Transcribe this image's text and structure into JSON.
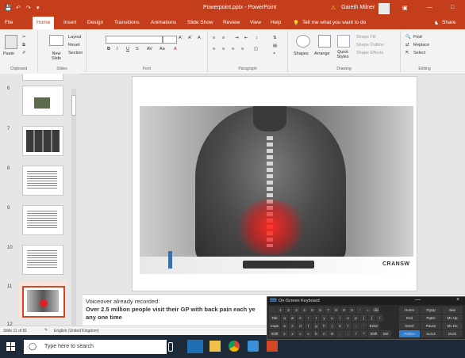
{
  "titlebar": {
    "quick_access": [
      "save-icon",
      "undo-icon",
      "redo-icon",
      "customize-icon"
    ],
    "doc_title": "Powerpoint.pptx - PowerPoint",
    "warning_icon": "warning-icon",
    "user_name": "Gareth Milner",
    "window_buttons": [
      "ribbon-display-icon",
      "minimize-icon",
      "maximize-icon"
    ]
  },
  "tabs": {
    "items": [
      "File",
      "Home",
      "Insert",
      "Design",
      "Transitions",
      "Animations",
      "Slide Show",
      "Review",
      "View",
      "Help"
    ],
    "active": "Home",
    "tell_me": "Tell me what you want to do",
    "share": "Share"
  },
  "ribbon": {
    "clipboard": {
      "paste": "Paste",
      "label": "Clipboard"
    },
    "slides": {
      "new_slide": "New Slide",
      "layout": "Layout",
      "reset": "Reset",
      "section": "Section",
      "label": "Slides"
    },
    "font": {
      "bold": "B",
      "italic": "I",
      "underline": "U",
      "strike": "S",
      "spacing": "AV",
      "label": "Font",
      "clear": "A"
    },
    "paragraph": {
      "label": "Paragraph"
    },
    "drawing": {
      "shapes": "Shapes",
      "arrange": "Arrange",
      "quick_styles": "Quick Styles",
      "shape_fill": "Shape Fill",
      "shape_outline": "Shape Outline",
      "shape_effects": "Shape Effects",
      "label": "Drawing"
    },
    "editing": {
      "find": "Find",
      "replace": "Replace",
      "select": "Select",
      "label": "Editing"
    }
  },
  "thumbs": {
    "items": [
      {
        "num": "6"
      },
      {
        "num": "7"
      },
      {
        "num": "8"
      },
      {
        "num": "9"
      },
      {
        "num": "10"
      },
      {
        "num": "11"
      },
      {
        "num": "12"
      }
    ],
    "selected": "11"
  },
  "slide": {
    "brand": "CRANSW",
    "notes_line1": "Voiceover already recorded:",
    "notes_line2": "Over 2.5 million people visit their GP with back pain each ye",
    "notes_line3": "any one time"
  },
  "status": {
    "slide_info": "Slide 11 of 81",
    "language": "English (United Kingdom)"
  },
  "taskbar": {
    "search_placeholder": "Type here to search",
    "apps": [
      "windows-icon",
      "file-explorer-icon",
      "chrome-icon",
      "settings-icon",
      "powerpoint-icon"
    ]
  },
  "osk": {
    "title": "On-Screen Keyboard",
    "row1": [
      "",
      "1",
      "2",
      "3",
      "4",
      "5",
      "6",
      "7",
      "8",
      "9",
      "0",
      "-",
      "=",
      "⌫"
    ],
    "row2": [
      "Tab",
      "q",
      "w",
      "e",
      "r",
      "t",
      "y",
      "u",
      "i",
      "o",
      "p",
      "[",
      "]",
      "\\"
    ],
    "row3": [
      "Caps",
      "a",
      "s",
      "d",
      "f",
      "g",
      "h",
      "j",
      "k",
      "l",
      ";",
      "'",
      "Enter"
    ],
    "row4": [
      "Shift",
      "z",
      "x",
      "c",
      "v",
      "b",
      "n",
      "m",
      ",",
      ".",
      "/",
      "^",
      "Shift",
      "Del"
    ],
    "nav": [
      [
        "Home",
        "PgUp",
        "Nav"
      ],
      [
        "End",
        "PgDn",
        "Mv Up"
      ],
      [
        "Insert",
        "Pause",
        "Mv Dn"
      ],
      [
        "PrtScn",
        "ScrLk",
        "Dock"
      ]
    ]
  },
  "colors": {
    "accent": "#c43e1c",
    "taskbar": "#1c2a3a",
    "osk": "#2b2b2b",
    "highlight_key": "#2d7dd2"
  }
}
